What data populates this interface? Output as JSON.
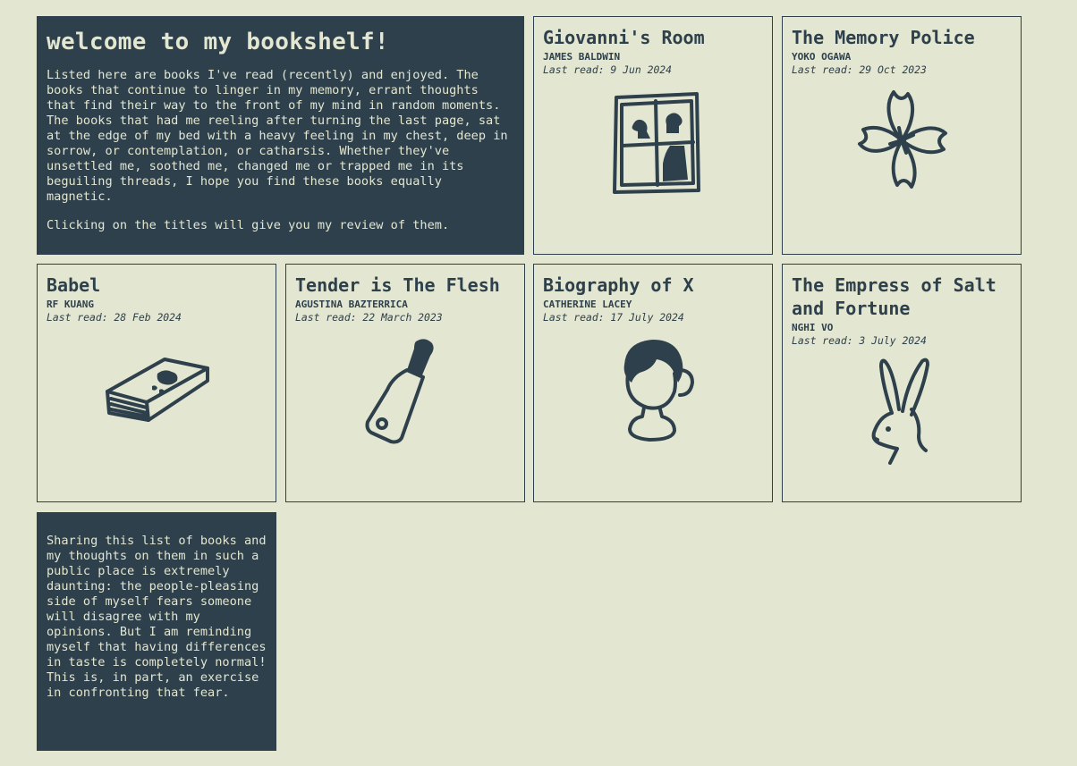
{
  "intro": {
    "title": "welcome to my bookshelf!",
    "paragraph1": "Listed here are books I've read (recently) and enjoyed. The books that continue to linger in my memory, errant thoughts that find their way to the front of my mind in random moments. The books that had me reeling after turning the last page, sat at the edge of my bed with a heavy feeling in my chest, deep in sorrow, or contemplation, or catharsis. Whether they've unsettled me, soothed me, changed me or trapped me in its beguiling threads, I hope you find these books equally magnetic.",
    "paragraph2": "Clicking on the titles will give you my review of them."
  },
  "books": [
    {
      "title": "Giovanni's Room",
      "author": "JAMES BALDWIN",
      "last_read": "Last read: 9 Jun 2024",
      "icon": "window-icon"
    },
    {
      "title": "The Memory Police",
      "author": "YOKO OGAWA",
      "last_read": "Last read: 29 Oct 2023",
      "icon": "flower-icon"
    },
    {
      "title": "Babel",
      "author": "RF KUANG",
      "last_read": "Last read: 28 Feb 2024",
      "icon": "book-icon"
    },
    {
      "title": "Tender is The Flesh",
      "author": "AGUSTINA BAZTERRICA",
      "last_read": "Last read: 22 March 2023",
      "icon": "cleaver-icon"
    },
    {
      "title": "Biography of X",
      "author": "CATHERINE LACEY",
      "last_read": "Last read: 17 July 2024",
      "icon": "bust-icon"
    },
    {
      "title": "The Empress of Salt and Fortune",
      "author": "NGHI VO",
      "last_read": "Last read: 3 July 2024",
      "icon": "rabbit-icon"
    }
  ],
  "outro": {
    "text": "Sharing this list of books and my thoughts on them in such a public place is extremely daunting: the people-pleasing side of myself fears someone will disagree with my opinions. But I am reminding myself that having differences in taste is completely normal! This is, in part, an exercise in confronting that fear."
  },
  "colors": {
    "background": "#e3e6d1",
    "ink": "#2e404b"
  }
}
